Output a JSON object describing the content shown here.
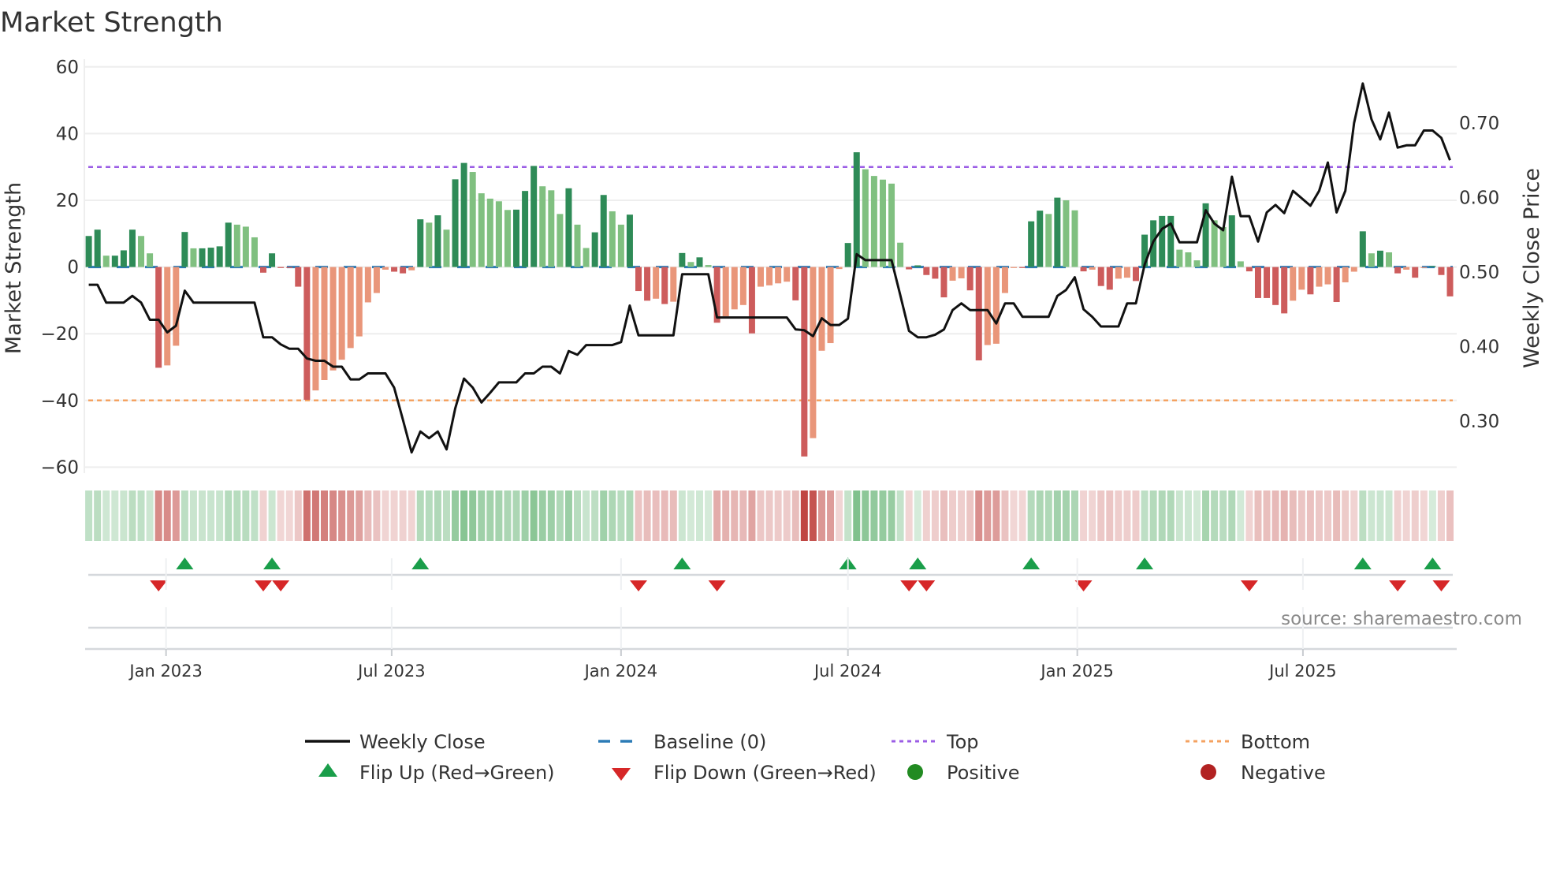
{
  "chart_data": {
    "type": "bar",
    "title": "Market Strength",
    "ylabel": "Market Strength",
    "y2label": "Weekly Close Price",
    "ylim": [
      -65,
      65
    ],
    "yticks": [
      60,
      40,
      20,
      0,
      -20,
      -40,
      -60
    ],
    "yticklabels": [
      "60",
      "40",
      "20",
      "0",
      "−20",
      "−40",
      "−60"
    ],
    "y2ticks": [
      0.7,
      0.6,
      0.5,
      0.4,
      0.3
    ],
    "y2ticklabels": [
      "0.70",
      "0.60",
      "0.50",
      "0.40",
      "0.30"
    ],
    "x_start": "2022-10-31",
    "x_step_days": 7,
    "xticks": [
      {
        "date": "2023-01-01",
        "label": "Jan 2023"
      },
      {
        "date": "2023-07-01",
        "label": "Jul 2023"
      },
      {
        "date": "2024-01-01",
        "label": "Jan 2024"
      },
      {
        "date": "2024-07-01",
        "label": "Jul 2024"
      },
      {
        "date": "2025-01-01",
        "label": "Jan 2025"
      },
      {
        "date": "2025-07-01",
        "label": "Jul 2025"
      }
    ],
    "top_level": 30,
    "bottom_level": -40,
    "baseline": 0,
    "grid": true,
    "legend_placement": "bottom-center",
    "series": [
      {
        "name": "Market Strength",
        "type": "bar",
        "values": [
          9.3,
          11.2,
          3.4,
          3.4,
          5,
          11.2,
          9.3,
          4.1,
          -30.2,
          -29.5,
          -23.6,
          10.5,
          5.6,
          5.6,
          5.8,
          6.2,
          13.3,
          12.7,
          12.1,
          8.9,
          -1.7,
          4.1,
          -0.3,
          -0.3,
          -5.9,
          -39.8,
          -37,
          -33.9,
          -31,
          -27.8,
          -24.3,
          -20.8,
          -10.6,
          -7.8,
          -0.8,
          -1.4,
          -1.9,
          -1,
          14.3,
          13.3,
          15.5,
          11.2,
          26.3,
          31.2,
          28.5,
          22.1,
          20.5,
          19.7,
          17.1,
          17.2,
          22.8,
          30.3,
          24.2,
          23,
          15.9,
          23.6,
          12.7,
          5.7,
          10.4,
          21.6,
          16.7,
          12.7,
          15.7,
          -7.2,
          -10.1,
          -9.5,
          -11.1,
          -10.4,
          4.2,
          1.5,
          2.9,
          0.6,
          -16.7,
          -14.8,
          -12.7,
          -11.4,
          -19.9,
          -5.9,
          -5.5,
          -4.9,
          -4.4,
          -10,
          -56.8,
          -51.3,
          -25.1,
          -22.8,
          -0.6,
          7.2,
          34.4,
          29.3,
          27.3,
          26.2,
          25,
          7.3,
          -0.7,
          0.5,
          -2.4,
          -3.5,
          -9.1,
          -4.1,
          -3.4,
          -7,
          -28,
          -23.4,
          -23,
          -7.8,
          -0.3,
          -0.3,
          13.7,
          16.9,
          15.9,
          20.8,
          20,
          17,
          -1.3,
          -0.8,
          -5.7,
          -6.8,
          -3.5,
          -3.2,
          -4.2,
          9.7,
          14,
          15.3,
          15.3,
          5.2,
          4.4,
          2,
          19.1,
          14,
          12,
          15.5,
          1.7,
          -1.3,
          -9.3,
          -9.3,
          -11.4,
          -13.9,
          -10.1,
          -6.8,
          -8.2,
          -5.9,
          -5.2,
          -10.5,
          -4.6,
          -1.4,
          10.7,
          4.1,
          4.9,
          4.4,
          -1.9,
          -0.8,
          -3.2,
          -0.3,
          0.3,
          -2.4,
          -8.8
        ]
      },
      {
        "name": "Weekly Close",
        "type": "line",
        "axis": "right",
        "values": [
          0.483,
          0.483,
          0.459,
          0.459,
          0.459,
          0.468,
          0.459,
          0.436,
          0.436,
          0.419,
          0.428,
          0.475,
          0.459,
          0.459,
          0.459,
          0.459,
          0.459,
          0.459,
          0.459,
          0.459,
          0.4125,
          0.4125,
          0.403,
          0.397,
          0.397,
          0.384,
          0.381,
          0.381,
          0.373,
          0.373,
          0.356,
          0.356,
          0.364,
          0.364,
          0.364,
          0.345,
          0.302,
          0.258,
          0.286,
          0.277,
          0.286,
          0.262,
          0.317,
          0.357,
          0.345,
          0.325,
          0.338,
          0.352,
          0.352,
          0.352,
          0.364,
          0.364,
          0.373,
          0.373,
          0.364,
          0.394,
          0.389,
          0.402,
          0.402,
          0.402,
          0.402,
          0.406,
          0.455,
          0.415,
          0.415,
          0.415,
          0.415,
          0.415,
          0.497,
          0.497,
          0.497,
          0.497,
          0.439,
          0.439,
          0.439,
          0.439,
          0.439,
          0.439,
          0.439,
          0.439,
          0.439,
          0.423,
          0.422,
          0.414,
          0.438,
          0.429,
          0.429,
          0.4375,
          0.524,
          0.516,
          0.516,
          0.516,
          0.516,
          0.469,
          0.421,
          0.4125,
          0.4125,
          0.416,
          0.423,
          0.449,
          0.458,
          0.449,
          0.449,
          0.449,
          0.431,
          0.458,
          0.458,
          0.44,
          0.44,
          0.44,
          0.44,
          0.468,
          0.476,
          0.493,
          0.45,
          0.44,
          0.427,
          0.427,
          0.427,
          0.458,
          0.458,
          0.51,
          0.541,
          0.558,
          0.565,
          0.54,
          0.54,
          0.54,
          0.583,
          0.565,
          0.556,
          0.628,
          0.575,
          0.575,
          0.541,
          0.58,
          0.59,
          0.579,
          0.609,
          0.599,
          0.589,
          0.609,
          0.647,
          0.58,
          0.609,
          0.7,
          0.753,
          0.705,
          0.678,
          0.714,
          0.667,
          0.67,
          0.67,
          0.69,
          0.69,
          0.68,
          0.65
        ]
      }
    ],
    "legend": [
      {
        "label": "Weekly Close",
        "icon": "solid-line-icon"
      },
      {
        "label": "Baseline (0)",
        "icon": "dashed-line-icon"
      },
      {
        "label": "Top",
        "icon": "dotted-line-icon"
      },
      {
        "label": "Bottom",
        "icon": "dotted-line-icon"
      },
      {
        "label": "Flip Up (Red→Green)",
        "icon": "triangle-up-icon"
      },
      {
        "label": "Flip Down (Green→Red)",
        "icon": "triangle-down-icon"
      },
      {
        "label": "Positive",
        "icon": "circle-icon"
      },
      {
        "label": "Negative",
        "icon": "circle-icon"
      }
    ],
    "source": "source: sharemaestro.com",
    "colors": {
      "pos_rising": "#2e8b57",
      "pos_falling": "#80c080",
      "neg_falling": "#cd5c5c",
      "neg_rising": "#e9967a",
      "line": "#111111",
      "baseline": "#2c7bb6",
      "top": "#9b5de5",
      "bottom": "#f4a261",
      "flip_up": "#1a9e4a",
      "flip_down": "#d62728",
      "positive": "#228b22",
      "negative": "#b22222"
    }
  }
}
